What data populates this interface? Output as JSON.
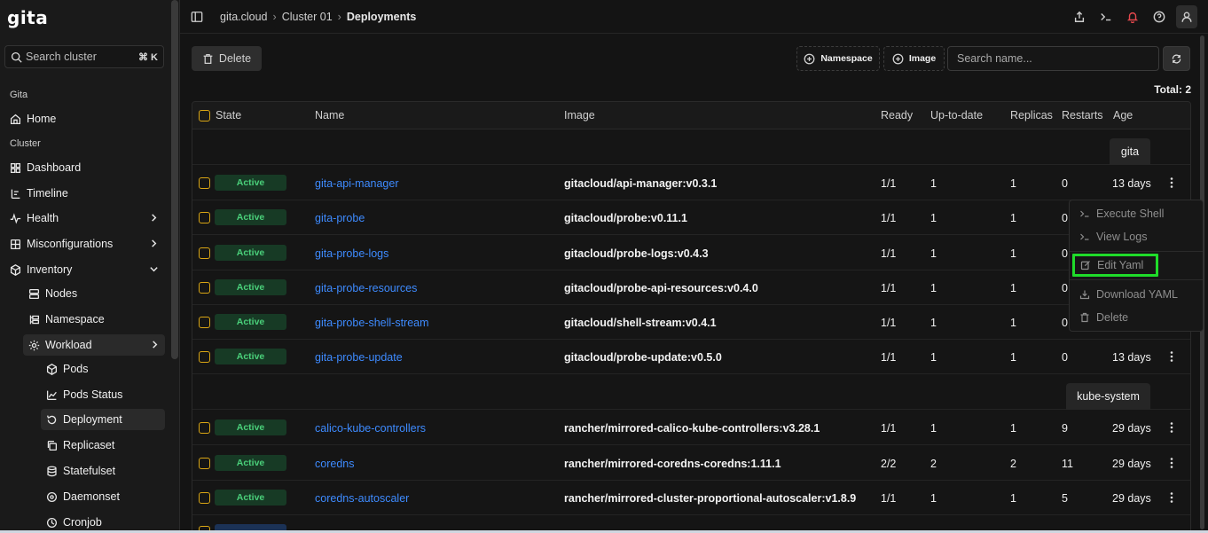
{
  "app": {
    "logo": "gita"
  },
  "sidebar": {
    "search_placeholder": "Search cluster",
    "search_shortcut": "⌘ K",
    "section_gita": "Gita",
    "home": "Home",
    "section_cluster": "Cluster",
    "dashboard": "Dashboard",
    "timeline": "Timeline",
    "health": "Health",
    "misconfigurations": "Misconfigurations",
    "inventory": "Inventory",
    "nodes": "Nodes",
    "namespace": "Namespace",
    "workload": "Workload",
    "pods": "Pods",
    "pods_status": "Pods Status",
    "deployment": "Deployment",
    "replicaset": "Replicaset",
    "statefulset": "Statefulset",
    "daemonset": "Daemonset",
    "cronjob": "Cronjob"
  },
  "breadcrumb": {
    "root": "gita.cloud",
    "cluster": "Cluster 01",
    "current": "Deployments"
  },
  "toolbar": {
    "delete_label": "Delete",
    "namespace_filter": "Namespace",
    "image_filter": "Image",
    "search_placeholder": "Search name...",
    "total": "Total: 2"
  },
  "table": {
    "headers": {
      "state": "State",
      "name": "Name",
      "image": "Image",
      "ready": "Ready",
      "uptodate": "Up-to-date",
      "replicas": "Replicas",
      "restarts": "Restarts",
      "age": "Age"
    },
    "groups": [
      {
        "label": "gita"
      },
      {
        "label": "kube-system"
      }
    ],
    "rows": [
      {
        "state": "Active",
        "name": "gita-api-manager",
        "image": "gitacloud/api-manager:v0.3.1",
        "ready": "1/1",
        "uptodate": "1",
        "replicas": "1",
        "restarts": "0",
        "age": "13 days"
      },
      {
        "state": "Active",
        "name": "gita-probe",
        "image": "gitacloud/probe:v0.11.1",
        "ready": "1/1",
        "uptodate": "1",
        "replicas": "1",
        "restarts": "0",
        "age": ""
      },
      {
        "state": "Active",
        "name": "gita-probe-logs",
        "image": "gitacloud/probe-logs:v0.4.3",
        "ready": "1/1",
        "uptodate": "1",
        "replicas": "1",
        "restarts": "0",
        "age": ""
      },
      {
        "state": "Active",
        "name": "gita-probe-resources",
        "image": "gitacloud/probe-api-resources:v0.4.0",
        "ready": "1/1",
        "uptodate": "1",
        "replicas": "1",
        "restarts": "0",
        "age": ""
      },
      {
        "state": "Active",
        "name": "gita-probe-shell-stream",
        "image": "gitacloud/shell-stream:v0.4.1",
        "ready": "1/1",
        "uptodate": "1",
        "replicas": "1",
        "restarts": "0",
        "age": ""
      },
      {
        "state": "Active",
        "name": "gita-probe-update",
        "image": "gitacloud/probe-update:v0.5.0",
        "ready": "1/1",
        "uptodate": "1",
        "replicas": "1",
        "restarts": "0",
        "age": "13 days"
      },
      {
        "state": "Active",
        "name": "calico-kube-controllers",
        "image": "rancher/mirrored-calico-kube-controllers:v3.28.1",
        "ready": "1/1",
        "uptodate": "1",
        "replicas": "1",
        "restarts": "9",
        "age": "29 days"
      },
      {
        "state": "Active",
        "name": "coredns",
        "image": "rancher/mirrored-coredns-coredns:1.11.1",
        "ready": "2/2",
        "uptodate": "2",
        "replicas": "2",
        "restarts": "11",
        "age": "29 days"
      },
      {
        "state": "Active",
        "name": "coredns-autoscaler",
        "image": "rancher/mirrored-cluster-proportional-autoscaler:v1.8.9",
        "ready": "1/1",
        "uptodate": "1",
        "replicas": "1",
        "restarts": "5",
        "age": "29 days"
      }
    ]
  },
  "context_menu": {
    "execute_shell": "Execute Shell",
    "view_logs": "View Logs",
    "edit_yaml": "Edit Yaml",
    "download_yaml": "Download YAML",
    "delete": "Delete"
  },
  "colors": {
    "accent_link": "#3e8bff",
    "active_badge": "#4ad07a",
    "checkbox": "#d9a514",
    "highlight": "#1fdc2a",
    "bell": "#e5484d"
  }
}
